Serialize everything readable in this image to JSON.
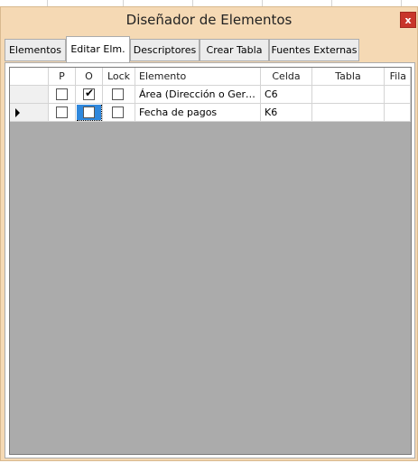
{
  "window": {
    "title": "Diseñador de Elementos",
    "close_label": "x"
  },
  "tabs": [
    {
      "label": "Elementos",
      "active": false
    },
    {
      "label": "Editar Elm.",
      "active": true
    },
    {
      "label": "Descriptores",
      "active": false
    },
    {
      "label": "Crear Tabla",
      "active": false
    },
    {
      "label": "Fuentes Externas",
      "active": false
    }
  ],
  "grid": {
    "columns": [
      "P",
      "O",
      "Lock",
      "Elemento",
      "Celda",
      "Tabla",
      "Fila"
    ],
    "rows": [
      {
        "p": false,
        "o": true,
        "lock": false,
        "elemento": "Área (Dirección o Gerencia)",
        "celda": "C6",
        "tabla": "",
        "fila": "",
        "current": false
      },
      {
        "p": false,
        "o": false,
        "lock": false,
        "elemento": "Fecha de pagos",
        "celda": "K6",
        "tabla": "",
        "fila": "",
        "current": true
      }
    ]
  },
  "colors": {
    "window_bg": "#f5d9b4",
    "close_button": "#c8352b",
    "grid_bg": "#ababab",
    "selection": "#2f88dd"
  }
}
